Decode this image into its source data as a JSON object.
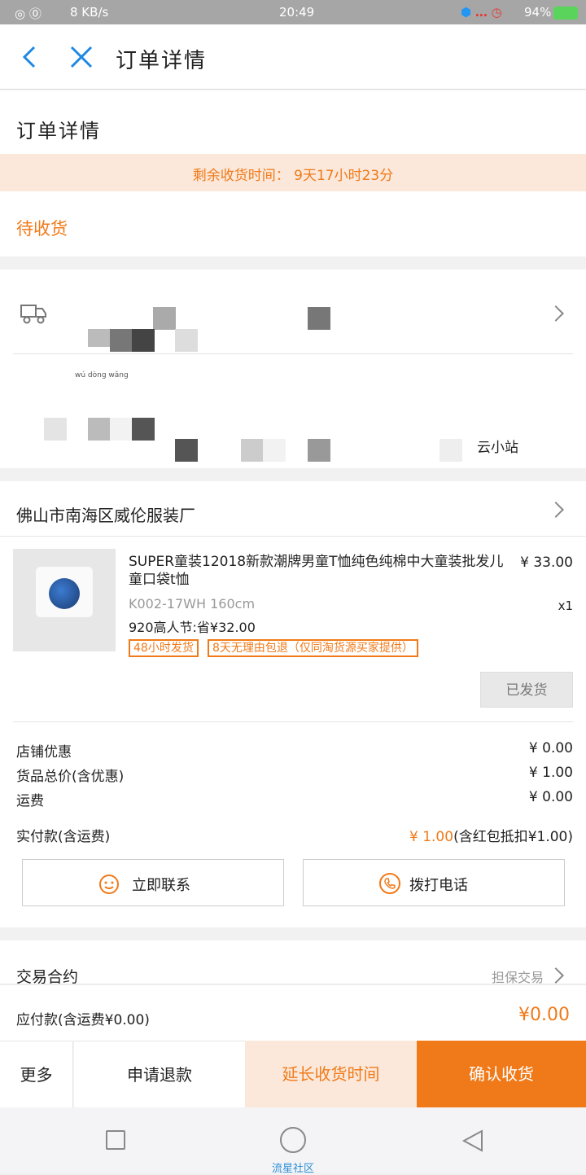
{
  "status_bar": {
    "left": "8 KB/s",
    "time": "20:49",
    "battery": "94%"
  },
  "header": {
    "title": "订单详情"
  },
  "page_heading": "订单详情",
  "countdown": {
    "label": "剩余收货时间：",
    "value": "9天17小时23分"
  },
  "order_status": "待收货",
  "logistics": {
    "partial_text": "wú  dòng  wǎng",
    "station": "云小站"
  },
  "shop": {
    "name": "佛山市南海区威伦服装厂"
  },
  "product": {
    "title": "SUPER童装12018新款潮牌男童T恤纯色纯棉中大童装批发儿童口袋t恤",
    "price": "¥ 33.00",
    "sku": "K002-17WH 160cm",
    "qty": "x1",
    "promo": "920高人节:省¥32.00",
    "tags": [
      "48小时发货",
      "8天无理由包退（仅同淘货源买家提供）"
    ],
    "shipped_label": "已发货"
  },
  "fees": {
    "shop_discount": {
      "label": "店铺优惠",
      "value": "¥ 0.00"
    },
    "goods_total": {
      "label": "货品总价(含优惠)",
      "value": "¥ 1.00"
    },
    "shipping": {
      "label": "运费",
      "value": "¥ 0.00"
    },
    "paid": {
      "label": "实付款(含运费)",
      "value": "¥ 1.00",
      "note": "(含红包抵扣¥1.00)"
    }
  },
  "actions": {
    "contact": "立即联系",
    "call": "拨打电话"
  },
  "contract": {
    "label": "交易合约",
    "value": "担保交易"
  },
  "due": {
    "label": "应付款(含运费¥0.00)",
    "value": "¥0.00"
  },
  "bottom": {
    "more": "更多",
    "refund": "申请退款",
    "extend": "延长收货时间",
    "confirm": "确认收货"
  },
  "nav": {
    "caption": "流星社区"
  },
  "colors": {
    "accent": "#f07a19",
    "countdown_bg": "#fbe8da",
    "blue": "#1e88e5"
  }
}
